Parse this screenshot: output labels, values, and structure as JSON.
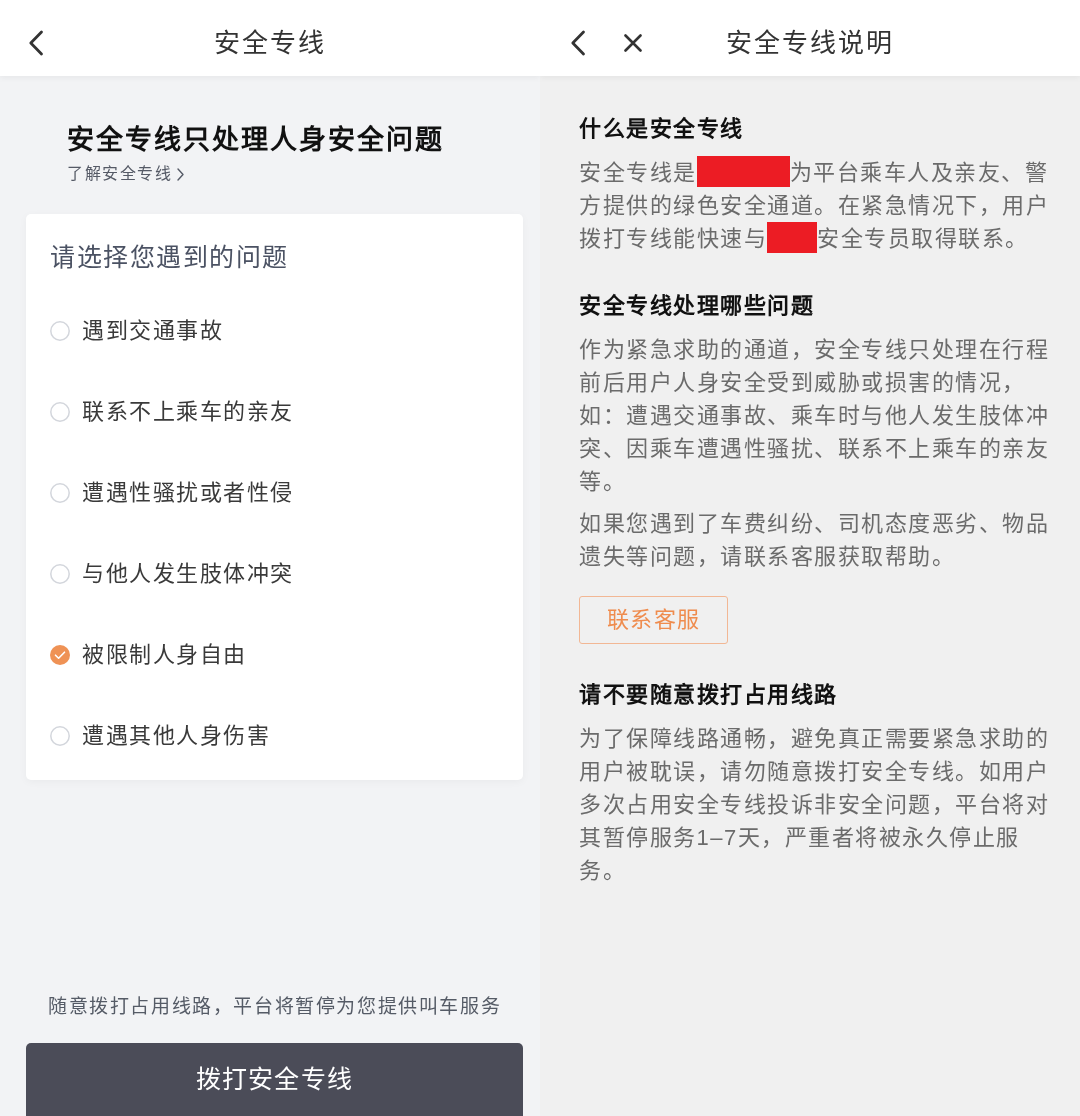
{
  "left_screen": {
    "header": {
      "title": "安全专线"
    },
    "headline": "安全专线只处理人身安全问题",
    "learn_more_link": "了解安全专线",
    "question_card": {
      "title": "请选择您遇到的问题",
      "options": [
        {
          "label": "遇到交通事故",
          "selected": false
        },
        {
          "label": "联系不上乘车的亲友",
          "selected": false
        },
        {
          "label": "遭遇性骚扰或者性侵",
          "selected": false
        },
        {
          "label": "与他人发生肢体冲突",
          "selected": false
        },
        {
          "label": "被限制人身自由",
          "selected": true
        },
        {
          "label": "遭遇其他人身伤害",
          "selected": false
        }
      ]
    },
    "warning_note": "随意拨打占用线路，平台将暂停为您提供叫车服务",
    "call_button": "拨打安全专线"
  },
  "right_screen": {
    "header": {
      "title": "安全专线说明"
    },
    "sections": [
      {
        "heading": "什么是安全专线",
        "blocks": [
          {
            "kind": "paragraph",
            "segments": [
              {
                "kind": "text",
                "text": "安全专线是"
              },
              {
                "kind": "redaction"
              },
              {
                "kind": "text",
                "text": "为平台乘车人及亲友、警方提供的绿色安全通道。在紧急情况下，用户拨打专线能快速与"
              },
              {
                "kind": "redaction"
              },
              {
                "kind": "text",
                "text": "安全专员取得联系。"
              }
            ]
          }
        ]
      },
      {
        "heading": "安全专线处理哪些问题",
        "blocks": [
          {
            "kind": "paragraph",
            "segments": [
              {
                "kind": "text",
                "text": "作为紧急求助的通道，安全专线只处理在行程前后用户人身安全受到威胁或损害的情况，如：遭遇交通事故、乘车时与他人发生肢体冲突、因乘车遭遇性骚扰、联系不上乘车的亲友等。"
              }
            ]
          },
          {
            "kind": "paragraph",
            "segments": [
              {
                "kind": "text",
                "text": "如果您遇到了车费纠纷、司机态度恶劣、物品遗失等问题，请联系客服获取帮助。"
              }
            ]
          },
          {
            "kind": "button",
            "label": "联系客服"
          }
        ]
      },
      {
        "heading": "请不要随意拨打占用线路",
        "blocks": [
          {
            "kind": "paragraph",
            "segments": [
              {
                "kind": "text",
                "text": "为了保障线路通畅，避免真正需要紧急求助的用户被耽误，请勿随意拨打安全专线。如用户多次占用安全专线投诉非安全问题，平台将对其暂停服务1–7天，严重者将被永久停止服务。"
              }
            ]
          }
        ]
      }
    ]
  }
}
